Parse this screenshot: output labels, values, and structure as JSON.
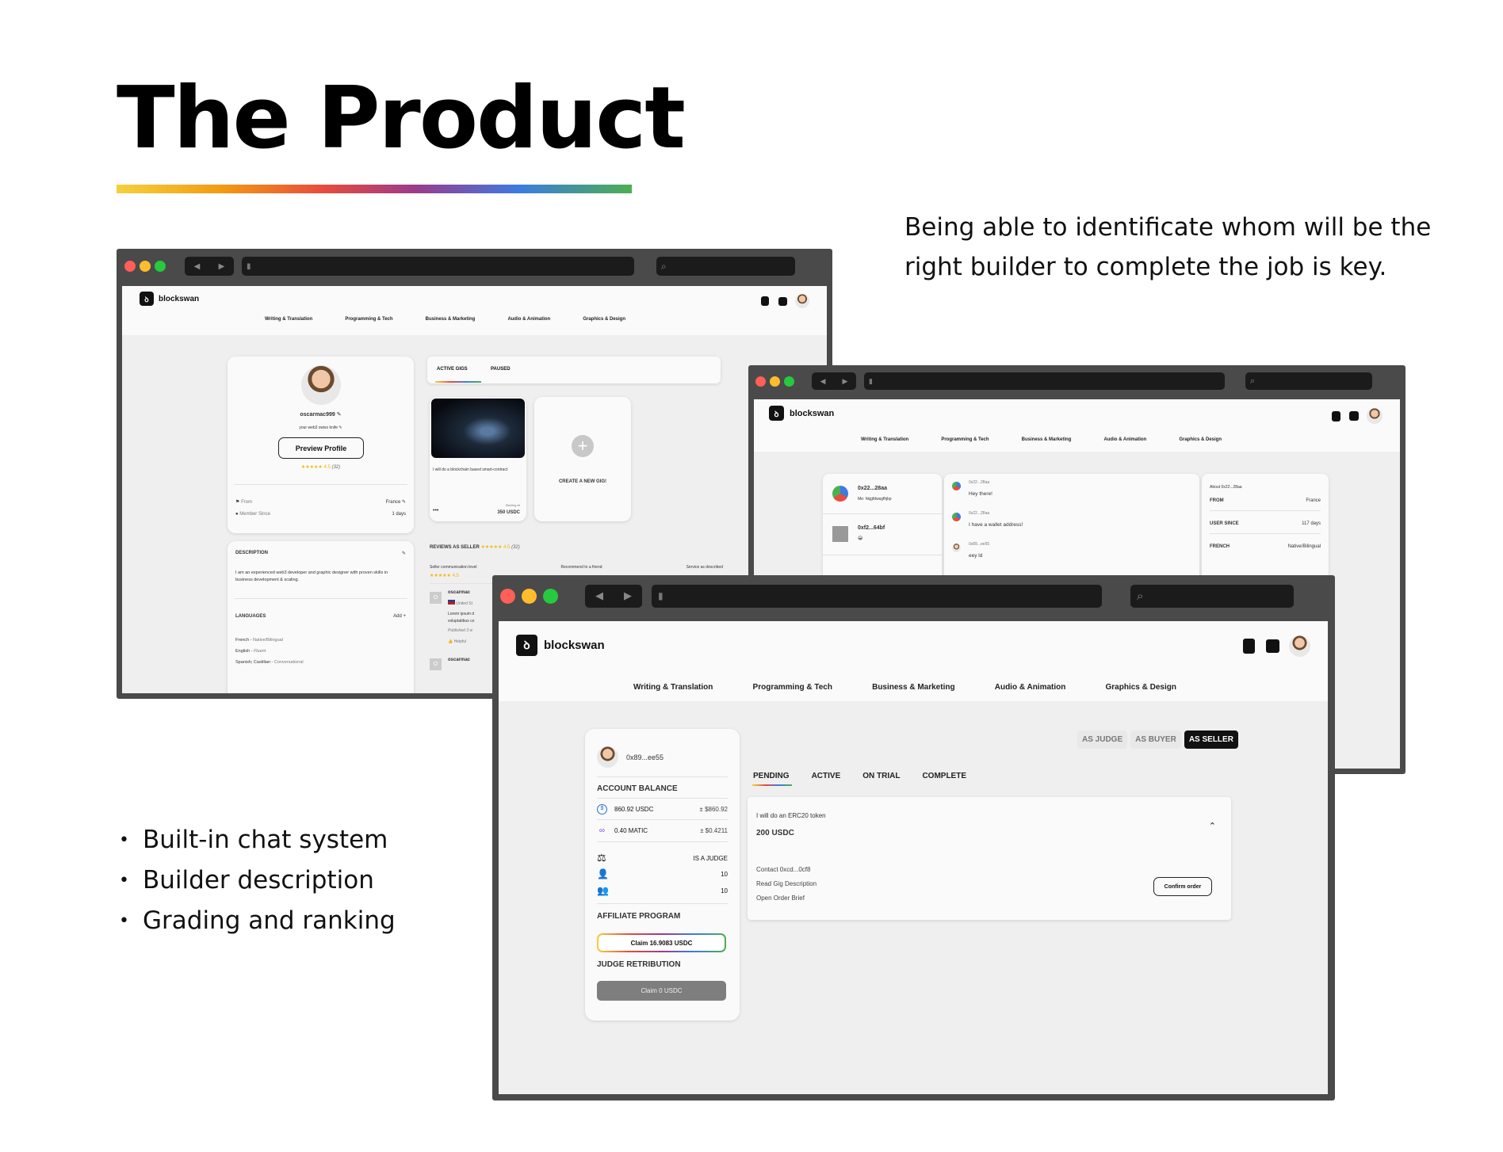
{
  "slide": {
    "title": "The Product",
    "tagline": "Being able to identificate whom will be the right builder to complete the job is key.",
    "bullets": [
      "Built-in chat system",
      "Builder description",
      "Grading and ranking"
    ]
  },
  "app": {
    "brand": "blockswan",
    "categories": [
      "Writing & Translation",
      "Programming & Tech",
      "Business & Marketing",
      "Audio & Animation",
      "Graphics & Design"
    ]
  },
  "profile_screen": {
    "username": "oscarmac999",
    "bio": "your web3 swiss knife",
    "preview_button": "Preview Profile",
    "rating": "4.5",
    "rating_count": "(32)",
    "from_label": "From",
    "from_value": "France",
    "member_label": "Member Since",
    "member_value": "1 days",
    "description_heading": "DESCRIPTION",
    "description_text": "I am an experienced web3 developer and graphic designer with proven skills in business development & scaling.",
    "languages_heading": "LANGUAGES",
    "add_label": "Add +",
    "languages": [
      {
        "name": "French",
        "level": "Native/Bilingual"
      },
      {
        "name": "English",
        "level": "Fluent"
      },
      {
        "name": "Spanish; Castilian",
        "level": "Conversational"
      }
    ],
    "tabs": [
      "ACTIVE GIGS",
      "PAUSED"
    ],
    "gig_title": "I will do a blockchain based smart-contract",
    "gig_more": "•••",
    "gig_starting_label": "Starting At",
    "gig_price": "350 USDC",
    "create_gig": "CREATE A NEW GIG!",
    "reviews_heading": "REVIEWS AS SELLER",
    "review_cols": [
      "Seller communication level",
      "Recommend to a friend",
      "Service as described"
    ],
    "reviewer": "oscarmac",
    "reviewer_country": "United St",
    "review_text": "Lorem ipsum d voluptatibus co",
    "review_published": "Published 3 w",
    "helpful": "Helpful",
    "reviewer_2": "oscarmac"
  },
  "chat_screen": {
    "conversations": [
      {
        "name": "0x22...28aa",
        "preview": "Me: hkjgfdwsgfhjkp"
      },
      {
        "name": "0xf2...64bf",
        "preview": "😀"
      }
    ],
    "messages": [
      {
        "sender": "0x22...28aa",
        "text": "Hey there!"
      },
      {
        "sender": "0x22...28aa",
        "text": "I have a wallet address!"
      },
      {
        "sender": "0x89...ee55",
        "text": "eey ld"
      }
    ],
    "about_title": "About 0x22...28aa",
    "about_rows": [
      {
        "label": "FROM",
        "value": "France"
      },
      {
        "label": "USER SINCE",
        "value": "117 days"
      },
      {
        "label": "FRENCH",
        "value": "Native/Bilingual"
      }
    ]
  },
  "orders_screen": {
    "wallet": "0x89...ee55",
    "balance_heading": "ACCOUNT BALANCE",
    "balances": [
      {
        "icon": "usdc-icon",
        "amount": "860.92 USDC",
        "usd": "± $860.92"
      },
      {
        "icon": "matic-icon",
        "amount": "0.40 MATIC",
        "usd": "± $0.4211"
      }
    ],
    "stats": [
      {
        "icon": "gavel-icon",
        "value": "IS A JUDGE"
      },
      {
        "icon": "user-plus-icon",
        "value": "10"
      },
      {
        "icon": "users-icon",
        "value": "10"
      }
    ],
    "affiliate_heading": "AFFILIATE PROGRAM",
    "affiliate_button": "Claim 16.9083 USDC",
    "judge_heading": "JUDGE RETRIBUTION",
    "judge_button": "Claim 0 USDC",
    "roles": [
      "AS JUDGE",
      "AS BUYER",
      "AS SELLER"
    ],
    "status_tabs": [
      "PENDING",
      "ACTIVE",
      "ON TRIAL",
      "COMPLETE"
    ],
    "order_title": "I will do an ERC20 token",
    "order_price": "200 USDC",
    "order_links": [
      "Contact 0xcd...0cf8",
      "Read Gig Description",
      "Open Order Brief"
    ],
    "confirm_button": "Confirm order"
  }
}
